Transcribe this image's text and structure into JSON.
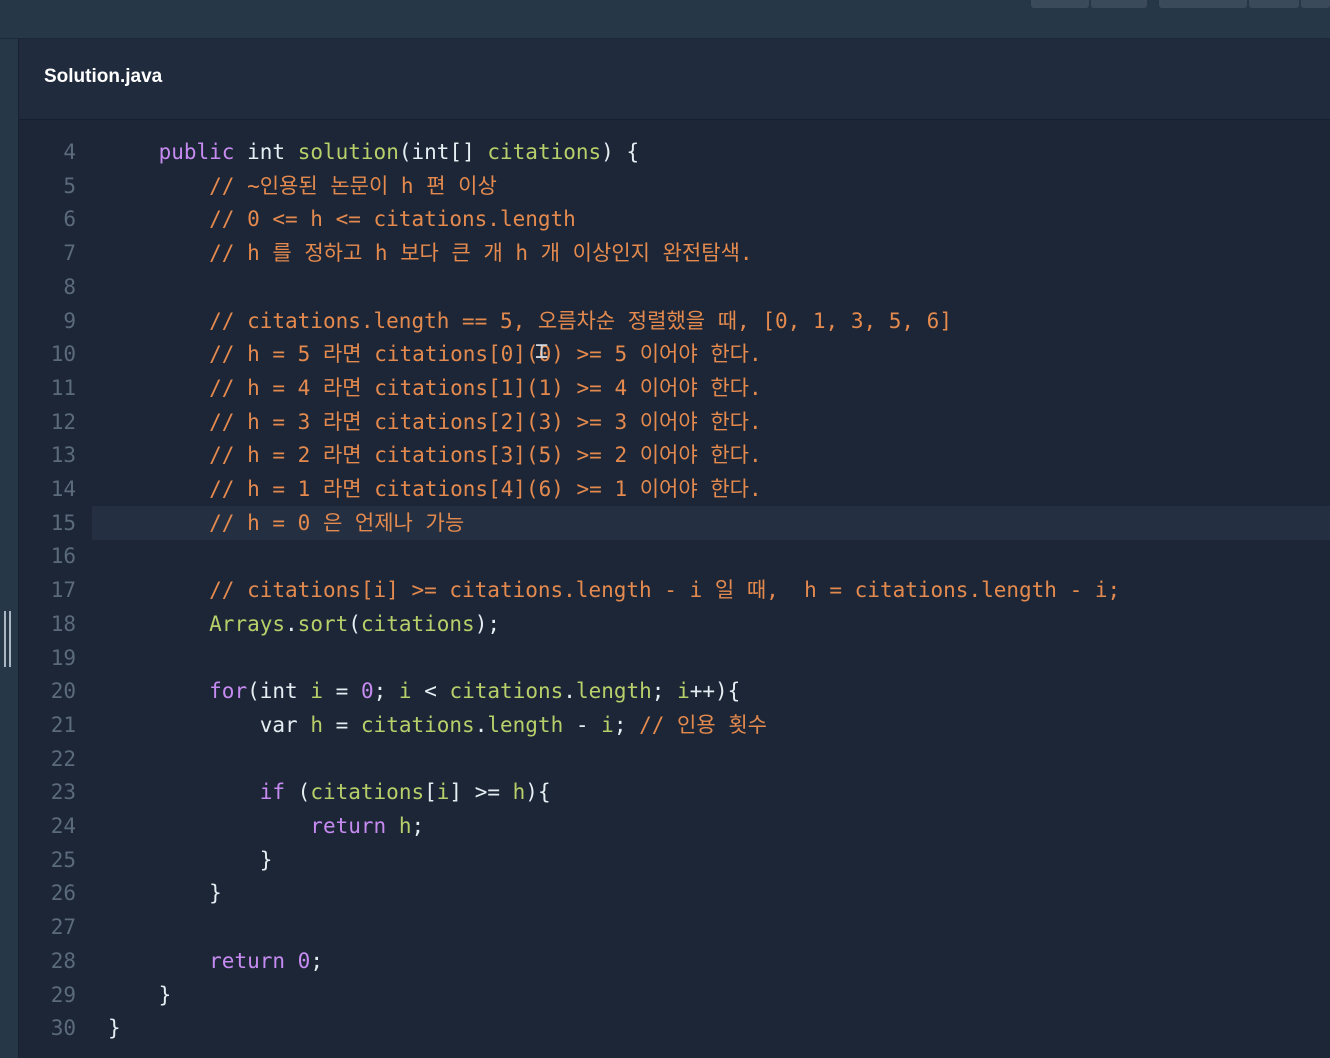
{
  "file_tab": {
    "name": "Solution.java"
  },
  "lines": [
    {
      "n": "4",
      "tokens": [
        [
          "    ",
          "pl"
        ],
        [
          "public",
          "kw"
        ],
        [
          " ",
          "pl"
        ],
        [
          "int",
          "tp"
        ],
        [
          " ",
          "pl"
        ],
        [
          "solution",
          "fn"
        ],
        [
          "(",
          "pl"
        ],
        [
          "int[]",
          "tp"
        ],
        [
          " ",
          "pl"
        ],
        [
          "citations",
          "fn"
        ],
        [
          ") {",
          "pl"
        ]
      ]
    },
    {
      "n": "5",
      "tokens": [
        [
          "        ",
          "pl"
        ],
        [
          "// ~인용된 논문이 h 편 이상",
          "cm"
        ]
      ]
    },
    {
      "n": "6",
      "tokens": [
        [
          "        ",
          "pl"
        ],
        [
          "// 0 <= h <= citations.length",
          "cm"
        ]
      ]
    },
    {
      "n": "7",
      "tokens": [
        [
          "        ",
          "pl"
        ],
        [
          "// h 를 정하고 h 보다 큰 개 h 개 이상인지 완전탐색.",
          "cm"
        ]
      ]
    },
    {
      "n": "8",
      "tokens": []
    },
    {
      "n": "9",
      "tokens": [
        [
          "        ",
          "pl"
        ],
        [
          "// citations.length == 5, 오름차순 정렬했을 때, [0, 1, 3, 5, 6]",
          "cm"
        ]
      ]
    },
    {
      "n": "10",
      "tokens": [
        [
          "        ",
          "pl"
        ],
        [
          "// h = 5 라면 citations[0](0) >= 5 이어야 한다.",
          "cm"
        ]
      ]
    },
    {
      "n": "11",
      "tokens": [
        [
          "        ",
          "pl"
        ],
        [
          "// h = 4 라면 citations[1](1) >= 4 이어야 한다.",
          "cm"
        ]
      ]
    },
    {
      "n": "12",
      "tokens": [
        [
          "        ",
          "pl"
        ],
        [
          "// h = 3 라면 citations[2](3) >= 3 이어야 한다.",
          "cm"
        ]
      ]
    },
    {
      "n": "13",
      "tokens": [
        [
          "        ",
          "pl"
        ],
        [
          "// h = 2 라면 citations[3](5) >= 2 이어야 한다.",
          "cm"
        ]
      ]
    },
    {
      "n": "14",
      "tokens": [
        [
          "        ",
          "pl"
        ],
        [
          "// h = 1 라면 citations[4](6) >= 1 이어야 한다.",
          "cm"
        ]
      ]
    },
    {
      "n": "15",
      "active": true,
      "tokens": [
        [
          "        ",
          "pl"
        ],
        [
          "// h = 0 은 언제나 가능",
          "cm"
        ]
      ]
    },
    {
      "n": "16",
      "tokens": []
    },
    {
      "n": "17",
      "tokens": [
        [
          "        ",
          "pl"
        ],
        [
          "// citations[i] >= citations.length - i 일 때,  h = citations.length - i;",
          "cm"
        ]
      ]
    },
    {
      "n": "18",
      "tokens": [
        [
          "        ",
          "pl"
        ],
        [
          "Arrays",
          "fn"
        ],
        [
          ".",
          "pl"
        ],
        [
          "sort",
          "fn"
        ],
        [
          "(",
          "pl"
        ],
        [
          "citations",
          "fn"
        ],
        [
          ");",
          "pl"
        ]
      ]
    },
    {
      "n": "19",
      "tokens": []
    },
    {
      "n": "20",
      "tokens": [
        [
          "        ",
          "pl"
        ],
        [
          "for",
          "kw"
        ],
        [
          "(",
          "pl"
        ],
        [
          "int",
          "tp"
        ],
        [
          " ",
          "pl"
        ],
        [
          "i",
          "fn"
        ],
        [
          " = ",
          "pl"
        ],
        [
          "0",
          "nm"
        ],
        [
          "; ",
          "pl"
        ],
        [
          "i",
          "fn"
        ],
        [
          " < ",
          "pl"
        ],
        [
          "citations",
          "fn"
        ],
        [
          ".",
          "pl"
        ],
        [
          "length",
          "fn"
        ],
        [
          "; ",
          "pl"
        ],
        [
          "i",
          "fn"
        ],
        [
          "++){",
          "pl"
        ]
      ]
    },
    {
      "n": "21",
      "tokens": [
        [
          "            ",
          "pl"
        ],
        [
          "var",
          "tp"
        ],
        [
          " ",
          "pl"
        ],
        [
          "h",
          "fn"
        ],
        [
          " = ",
          "pl"
        ],
        [
          "citations",
          "fn"
        ],
        [
          ".",
          "pl"
        ],
        [
          "length",
          "fn"
        ],
        [
          " - ",
          "pl"
        ],
        [
          "i",
          "fn"
        ],
        [
          "; ",
          "pl"
        ],
        [
          "// 인용 횟수",
          "cm"
        ]
      ]
    },
    {
      "n": "22",
      "tokens": []
    },
    {
      "n": "23",
      "tokens": [
        [
          "            ",
          "pl"
        ],
        [
          "if",
          "kw"
        ],
        [
          " (",
          "pl"
        ],
        [
          "citations",
          "fn"
        ],
        [
          "[",
          "pl"
        ],
        [
          "i",
          "fn"
        ],
        [
          "] >= ",
          "pl"
        ],
        [
          "h",
          "fn"
        ],
        [
          "){",
          "pl"
        ]
      ]
    },
    {
      "n": "24",
      "tokens": [
        [
          "                ",
          "pl"
        ],
        [
          "return",
          "kw"
        ],
        [
          " ",
          "pl"
        ],
        [
          "h",
          "fn"
        ],
        [
          ";",
          "pl"
        ]
      ]
    },
    {
      "n": "25",
      "tokens": [
        [
          "            ",
          "pl"
        ],
        [
          "}",
          "pl"
        ]
      ]
    },
    {
      "n": "26",
      "tokens": [
        [
          "        ",
          "pl"
        ],
        [
          "}",
          "pl"
        ]
      ]
    },
    {
      "n": "27",
      "tokens": []
    },
    {
      "n": "28",
      "tokens": [
        [
          "        ",
          "pl"
        ],
        [
          "return",
          "kw"
        ],
        [
          " ",
          "pl"
        ],
        [
          "0",
          "nm"
        ],
        [
          ";",
          "pl"
        ]
      ]
    },
    {
      "n": "29",
      "tokens": [
        [
          "    ",
          "pl"
        ],
        [
          "}",
          "pl"
        ]
      ]
    },
    {
      "n": "30",
      "tokens": [
        [
          "}",
          "pl"
        ]
      ]
    }
  ],
  "colors": {
    "editor_bg": "#1c2636",
    "keyword": "#c68bf0",
    "identifier": "#b8cf6a",
    "comment": "#e58a4e",
    "plain": "#e6edf3",
    "line_number": "#5b6b7c",
    "active_line": "#243041"
  },
  "cursor_icon": "text-cursor-icon"
}
